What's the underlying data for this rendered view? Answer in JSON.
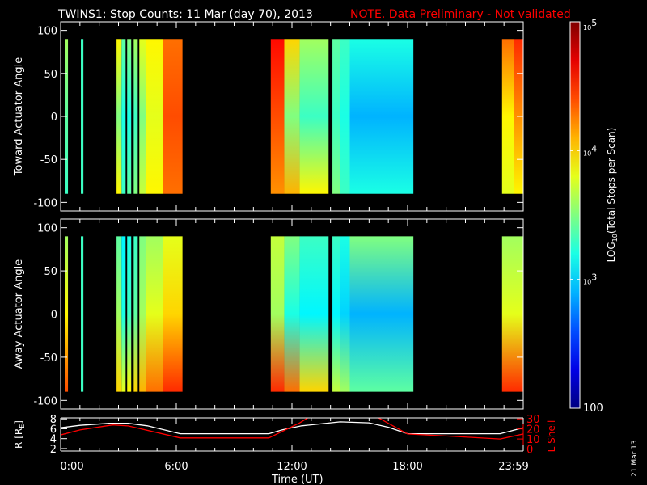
{
  "title": {
    "main": "TWINS1: Stop Counts: 11 Mar (day  70), 2013",
    "note": "NOTE. Data Preliminary - Not validated",
    "note_color": "#ff0000"
  },
  "date_stamp": "21 Mar 13",
  "chart_data": [
    {
      "type": "heatmap",
      "name": "toward",
      "ylabel": "Toward Actuator Angle",
      "ylim": [
        -110,
        110
      ],
      "yticks": [
        "100",
        "50",
        "0",
        "-50",
        "-100"
      ],
      "ytick_values": [
        100,
        50,
        0,
        -50,
        -100
      ],
      "xlim_hours": [
        0,
        24
      ],
      "angle_range": [
        -90,
        90
      ],
      "segments": [
        {
          "start": 0.21,
          "end": 0.38,
          "log": [
            3.3,
            3.4,
            3.6
          ]
        },
        {
          "start": 1.05,
          "end": 1.18,
          "log": [
            3.3,
            3.3,
            3.3
          ]
        },
        {
          "start": 2.9,
          "end": 3.16,
          "log": [
            3.9,
            3.5,
            3.9
          ]
        },
        {
          "start": 3.16,
          "end": 3.37,
          "log": [
            3.3,
            3.2,
            3.4
          ]
        },
        {
          "start": 3.45,
          "end": 3.66,
          "log": [
            3.4,
            3.2,
            3.5
          ]
        },
        {
          "start": 3.79,
          "end": 4.0,
          "log": [
            3.5,
            3.3,
            3.6
          ]
        },
        {
          "start": 4.08,
          "end": 4.42,
          "log": [
            3.7,
            3.5,
            3.8
          ]
        },
        {
          "start": 4.42,
          "end": 5.3,
          "log": [
            3.9,
            3.8,
            3.9
          ]
        },
        {
          "start": 5.3,
          "end": 6.32,
          "log": [
            4.3,
            4.4,
            4.3
          ]
        },
        {
          "start": 10.9,
          "end": 11.6,
          "log": [
            4.2,
            4.4,
            4.6
          ]
        },
        {
          "start": 11.6,
          "end": 12.4,
          "log": [
            4.1,
            3.5,
            4.0
          ]
        },
        {
          "start": 12.4,
          "end": 13.9,
          "log": [
            3.9,
            3.3,
            3.6
          ]
        },
        {
          "start": 14.1,
          "end": 14.5,
          "log": [
            3.5,
            3.3,
            3.4
          ]
        },
        {
          "start": 14.5,
          "end": 15.0,
          "log": [
            3.3,
            3.2,
            3.3
          ]
        },
        {
          "start": 15.0,
          "end": 18.3,
          "log": [
            3.2,
            2.9,
            3.2
          ]
        },
        {
          "start": 22.9,
          "end": 23.5,
          "log": [
            3.8,
            3.9,
            4.3
          ]
        },
        {
          "start": 23.5,
          "end": 24.0,
          "log": [
            3.9,
            4.2,
            4.5
          ]
        }
      ]
    },
    {
      "type": "heatmap",
      "name": "away",
      "ylabel": "Away Actuator Angle",
      "ylim": [
        -110,
        110
      ],
      "yticks": [
        "100",
        "50",
        "0",
        "-50",
        "-100"
      ],
      "ytick_values": [
        100,
        50,
        0,
        -50,
        -100
      ],
      "xlim_hours": [
        0,
        24
      ],
      "angle_range": [
        -90,
        90
      ],
      "segments": [
        {
          "start": 0.21,
          "end": 0.38,
          "log": [
            4.4,
            3.9,
            3.6
          ]
        },
        {
          "start": 1.05,
          "end": 1.18,
          "log": [
            3.3,
            3.3,
            3.3
          ]
        },
        {
          "start": 2.9,
          "end": 3.16,
          "log": [
            4.0,
            3.6,
            3.4
          ]
        },
        {
          "start": 3.16,
          "end": 3.37,
          "log": [
            3.8,
            3.2,
            3.1
          ]
        },
        {
          "start": 3.45,
          "end": 3.66,
          "log": [
            3.9,
            3.3,
            3.2
          ]
        },
        {
          "start": 3.79,
          "end": 4.0,
          "log": [
            4.0,
            3.4,
            3.3
          ]
        },
        {
          "start": 4.08,
          "end": 4.42,
          "log": [
            4.1,
            3.6,
            3.5
          ]
        },
        {
          "start": 4.42,
          "end": 5.3,
          "log": [
            4.3,
            3.8,
            3.6
          ]
        },
        {
          "start": 5.3,
          "end": 6.32,
          "log": [
            4.5,
            4.0,
            3.8
          ]
        },
        {
          "start": 10.9,
          "end": 11.6,
          "log": [
            4.5,
            3.6,
            3.7
          ]
        },
        {
          "start": 11.6,
          "end": 12.4,
          "log": [
            4.3,
            3.2,
            3.5
          ]
        },
        {
          "start": 12.4,
          "end": 13.9,
          "log": [
            4.0,
            3.1,
            3.3
          ]
        },
        {
          "start": 14.1,
          "end": 14.5,
          "log": [
            3.7,
            3.1,
            3.3
          ]
        },
        {
          "start": 14.5,
          "end": 15.0,
          "log": [
            3.6,
            3.0,
            3.2
          ]
        },
        {
          "start": 15.0,
          "end": 18.3,
          "log": [
            3.4,
            2.9,
            3.5
          ]
        },
        {
          "start": 22.9,
          "end": 24.0,
          "log": [
            4.5,
            3.8,
            3.6
          ]
        }
      ]
    },
    {
      "type": "line",
      "name": "orbit",
      "xlabel": "Time (UT)",
      "xticks": [
        "0:00",
        "6:00",
        "12:00",
        "18:00",
        "23:59"
      ],
      "xtick_hours": [
        0,
        6,
        12,
        18,
        24
      ],
      "ylabel_left": "R [R",
      "ylabel_left_sub": "E",
      "ylabel_left_end": "]",
      "ylim_left": [
        1.5,
        8.2
      ],
      "yticks_left": [
        "8",
        "6",
        "4",
        "2"
      ],
      "ytick_values_left": [
        8,
        6,
        4,
        2
      ],
      "ylabel_right": "L Shell",
      "ylim_right": [
        -2,
        31
      ],
      "yticks_right": [
        "30",
        "20",
        "10",
        "0"
      ],
      "ytick_values_right": [
        30,
        20,
        10,
        0
      ],
      "series": [
        {
          "name": "R",
          "color": "#ffffff",
          "axis": "left",
          "x": [
            0,
            1,
            2.5,
            3.5,
            4.5,
            6.2,
            10.8,
            11.5,
            12.5,
            14.5,
            16,
            17,
            18,
            22.8,
            24
          ],
          "y": [
            6.2,
            6.7,
            7.1,
            7.1,
            6.6,
            5.0,
            5.0,
            5.8,
            6.6,
            7.4,
            7.2,
            6.3,
            5.0,
            5.0,
            6.2
          ]
        },
        {
          "name": "L Shell",
          "color": "#ff0000",
          "axis": "right",
          "x": [
            0,
            1,
            2.7,
            3.5,
            6.2,
            10.8,
            12.4,
            12.9,
            null,
            16.4,
            18,
            20,
            22.8,
            24
          ],
          "y": [
            14,
            19,
            24,
            23,
            11,
            11,
            26,
            32,
            null,
            32,
            15,
            13,
            10,
            15
          ]
        }
      ]
    }
  ],
  "colorbar": {
    "label": "LOG",
    "label_sub": "10",
    "label_rest": "(Total Stops per Scan)",
    "ticks": [
      {
        "base": "10",
        "exp": "5",
        "log": 5
      },
      {
        "base": "10",
        "exp": "4",
        "log": 4
      },
      {
        "base": "10",
        "exp": "3",
        "log": 3
      }
    ],
    "min_label": "100",
    "range_log": [
      2,
      5
    ]
  }
}
